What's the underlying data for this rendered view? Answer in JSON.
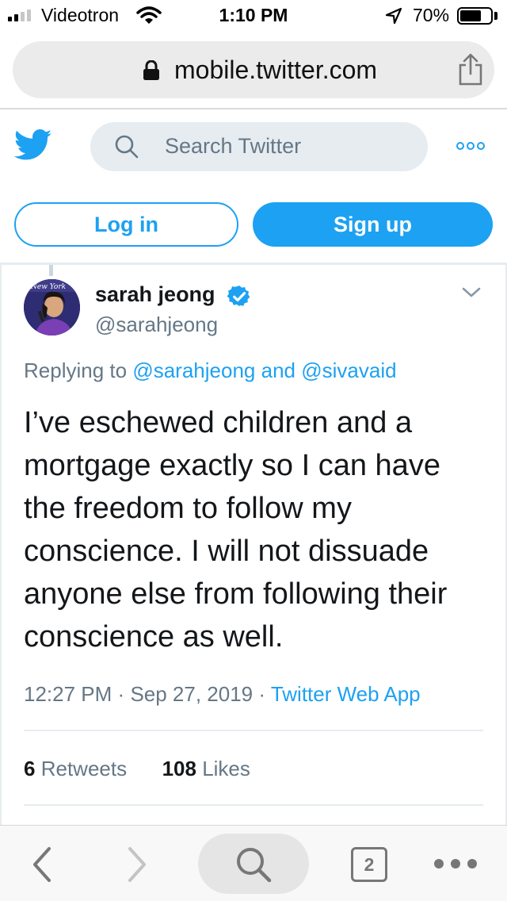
{
  "status_bar": {
    "carrier": "Videotron",
    "time": "1:10 PM",
    "battery_percent": "70%",
    "battery_level": 0.7
  },
  "browser": {
    "url": "mobile.twitter.com",
    "open_tabs": "2"
  },
  "header": {
    "search_placeholder": "Search Twitter",
    "login_label": "Log in",
    "signup_label": "Sign up"
  },
  "tweet": {
    "display_name": "sarah jeong",
    "handle": "@sarahjeong",
    "replying_prefix": "Replying to",
    "replying_user1": "@sarahjeong",
    "replying_and": "and",
    "replying_user2": "@sivavaid",
    "text_lines": [
      "I’ve eschewed children and a",
      "mortgage exactly so I can have",
      "the freedom to follow my",
      "conscience. I will not dissuade",
      "anyone else from following their",
      "conscience as well."
    ],
    "time": "12:27 PM",
    "date": "Sep 27, 2019",
    "source": "Twitter Web App",
    "retweets_count": "6",
    "retweets_label": "Retweets",
    "likes_count": "108",
    "likes_label": "Likes",
    "avatar_banner_text": "New York"
  },
  "colors": {
    "twitter_blue": "#1da1f2",
    "secondary_text": "#657786",
    "divider": "#e6ecf0"
  },
  "icons": [
    "signal-icon",
    "wifi-icon",
    "location-arrow-icon",
    "battery-icon",
    "lock-icon",
    "share-icon",
    "twitter-bird-icon",
    "search-icon",
    "more-icon",
    "verified-badge-icon",
    "chevron-down-icon",
    "back-icon",
    "forward-icon",
    "tabs-icon"
  ]
}
